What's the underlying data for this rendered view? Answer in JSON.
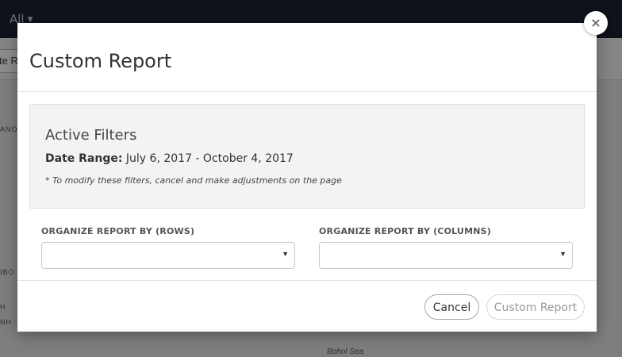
{
  "background": {
    "topbar": {
      "filter_label": "All"
    },
    "map_tab_label": "te R",
    "map_labels": [
      "ANO",
      "IBO",
      "H",
      "NH"
    ],
    "sea_label": "Bohol Sea"
  },
  "modal": {
    "title": "Custom Report",
    "close_icon": "close-icon",
    "active_filters": {
      "title": "Active Filters",
      "date_range_label": "Date Range:",
      "date_range_value": "July 6, 2017 - October 4, 2017",
      "note": "* To modify these filters, cancel and make adjustments on the page"
    },
    "rows_select": {
      "label": "ORGANIZE REPORT BY (ROWS)",
      "value": ""
    },
    "columns_select": {
      "label": "ORGANIZE REPORT BY (COLUMNS)",
      "value": ""
    },
    "buttons": {
      "cancel": "Cancel",
      "submit": "Custom Report"
    }
  },
  "colors": {
    "topbar": "#1a2230",
    "overlay": "rgba(0,0,0,0.45)",
    "modal_bg": "#ffffff",
    "panel_bg": "#f3f3f3"
  }
}
